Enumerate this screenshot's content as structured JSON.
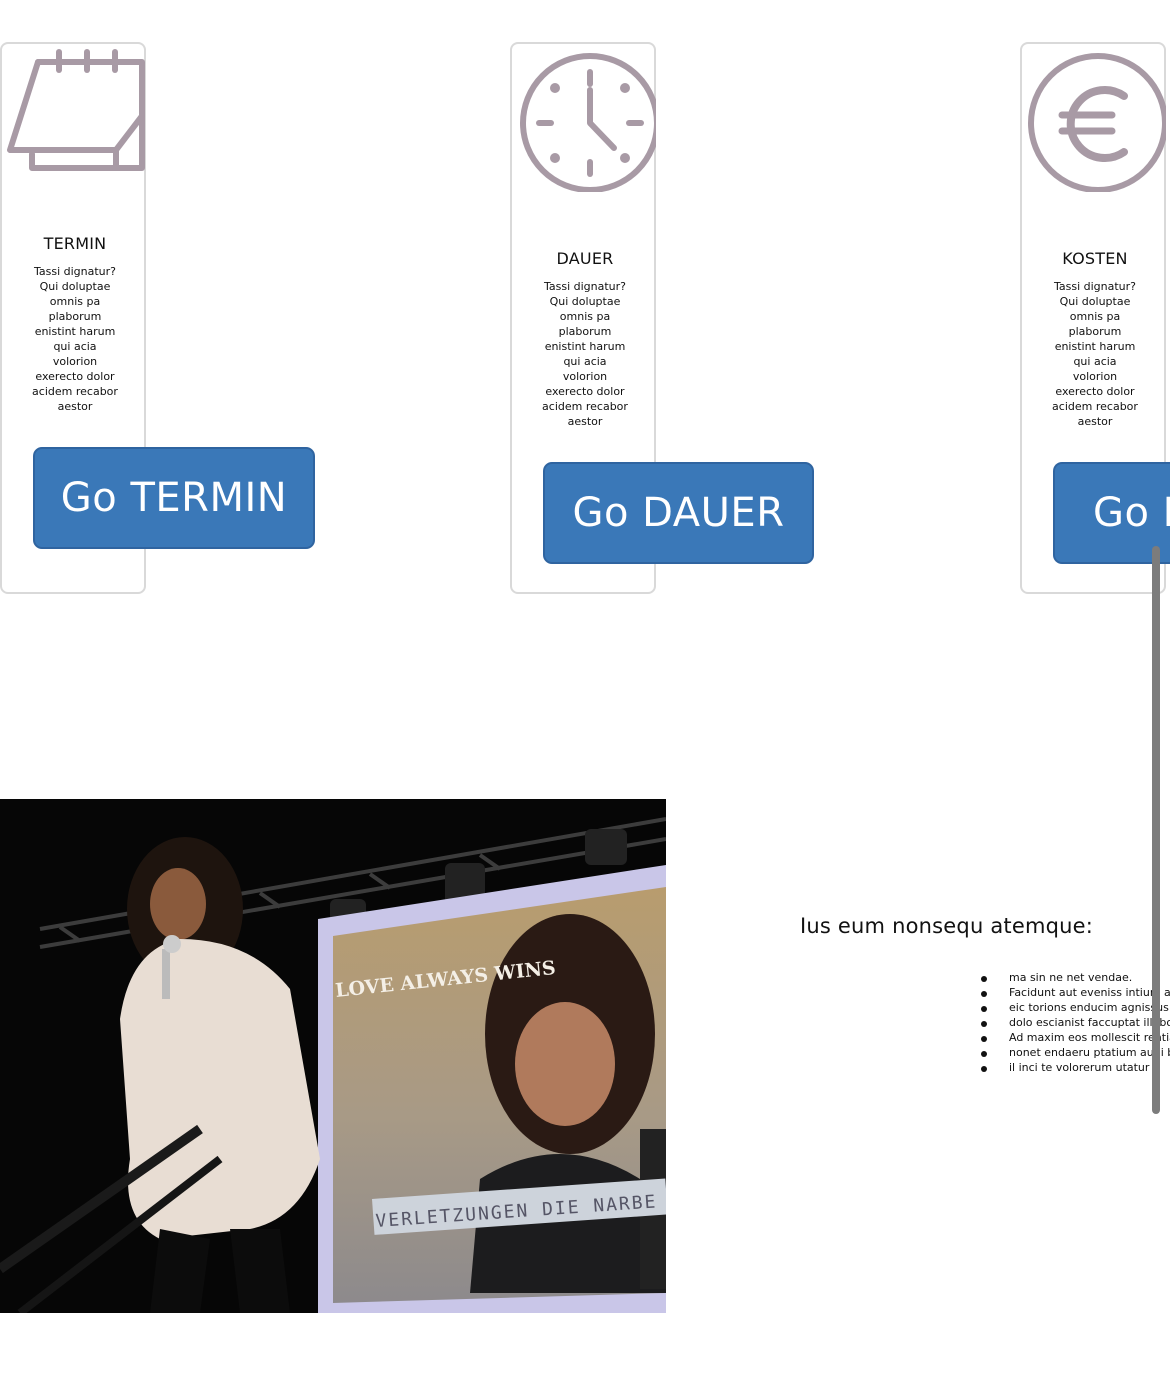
{
  "colors": {
    "icon": "#a89aa5",
    "button": "#3a78b8",
    "card_border": "#d9d9d9"
  },
  "cards": [
    {
      "icon": "calendar-icon",
      "title": "TERMIN",
      "desc": [
        "Tassi dignatur?",
        "Qui doluptae",
        "omnis pa",
        "plaborum",
        "enistint harum",
        "qui acia",
        "volorion",
        "exerecto dolor",
        "acidem recabor",
        "aestor"
      ],
      "button": "Go TERMIN"
    },
    {
      "icon": "clock-icon",
      "title": "DAUER",
      "desc": [
        "Tassi dignatur?",
        "Qui doluptae",
        "omnis pa",
        "plaborum",
        "enistint harum",
        "qui acia",
        "volorion",
        "exerecto dolor",
        "acidem recabor",
        "aestor"
      ],
      "button": "Go DAUER"
    },
    {
      "icon": "euro-icon",
      "title": "KOSTEN",
      "desc": [
        "Tassi dignatur?",
        "Qui doluptae",
        "omnis pa",
        "plaborum",
        "enistint harum",
        "qui acia",
        "volorion",
        "exerecto dolor",
        "acidem recabor",
        "aestor"
      ],
      "button": "Go KOSTEN"
    }
  ],
  "photo": {
    "screen_text_1": "LOVE ALWAYS WINS",
    "screen_text_2": "VERLETZUNGEN DIE NARBE"
  },
  "list": {
    "heading": "Ius eum nonsequ atemque:",
    "items": [
      "ma sin ne net vendae.",
      "Facidunt aut eveniss intium alis",
      "eic torions enducim agnissus m",
      "dolo escianist faccuptat illabo.",
      "Ad maxim eos mollescit rentiae",
      "nonet endaeru ptatium audi bl",
      "il inci te volorerum utatur"
    ]
  }
}
